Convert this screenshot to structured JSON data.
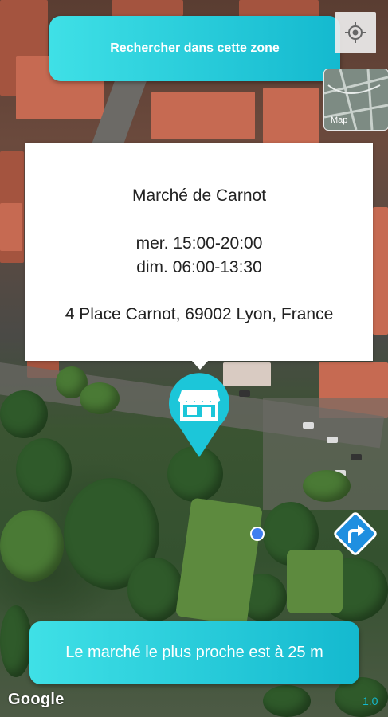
{
  "search_area_button": {
    "label": "Rechercher dans cette zone"
  },
  "map_type_button": {
    "label": "Map"
  },
  "locate_button": {
    "icon": "crosshair-icon"
  },
  "info_card": {
    "title": "Marché de Carnot",
    "hours": [
      "mer. 15:00-20:00",
      "dim. 06:00-13:30"
    ],
    "address": "4 Place Carnot, 69002 Lyon, France"
  },
  "market_marker": {
    "icon": "storefront-icon",
    "color": "#1cc6d9"
  },
  "directions_button": {
    "icon": "turn-right-arrow-icon",
    "color": "#1f8fe0"
  },
  "nearest_button": {
    "label": "Le marché le plus proche est à 25 m"
  },
  "map_attribution": {
    "label": "Google"
  },
  "zoom_level": {
    "label": "1.0"
  },
  "colors": {
    "accent": "#14b9cf",
    "accent_light": "#3fe0e6"
  }
}
